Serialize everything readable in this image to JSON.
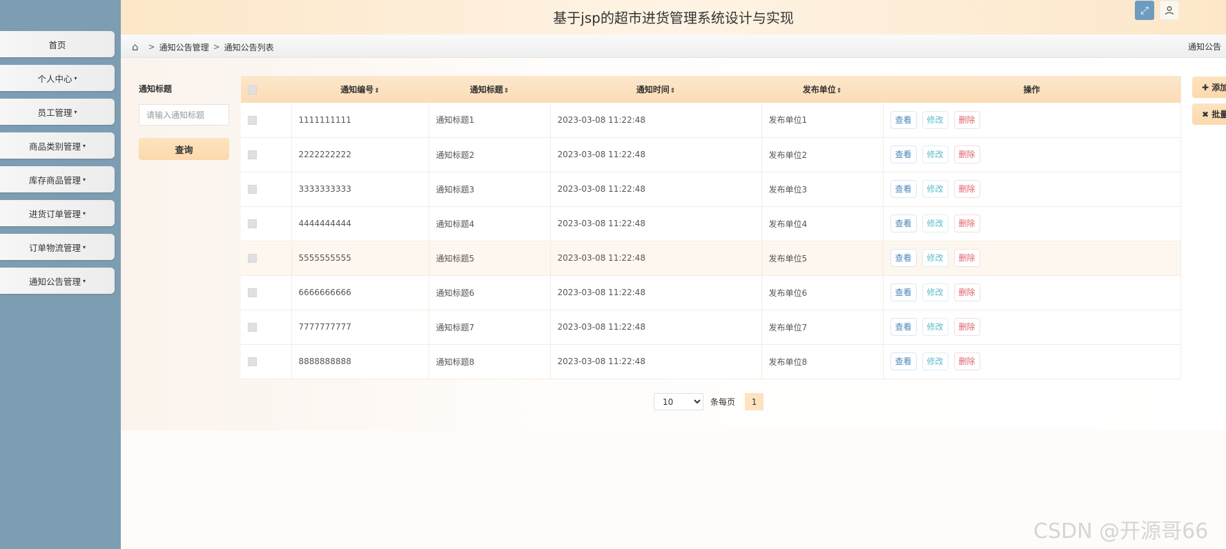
{
  "app": {
    "title": "基于jsp的超市进货管理系统设计与实现",
    "fullscreen_icon": "fullscreen-icon",
    "user_icon": "user-icon"
  },
  "sidebar": {
    "items": [
      {
        "label": "首页",
        "caret": ""
      },
      {
        "label": "个人中心",
        "caret": "▾"
      },
      {
        "label": "员工管理",
        "caret": "▾"
      },
      {
        "label": "商品类别管理",
        "caret": "▾"
      },
      {
        "label": "库存商品管理",
        "caret": "▾"
      },
      {
        "label": "进货订单管理",
        "caret": "▾"
      },
      {
        "label": "订单物流管理",
        "caret": "▾"
      },
      {
        "label": "通知公告管理",
        "caret": "▾"
      }
    ]
  },
  "breadcrumb": {
    "home_icon": "⌂",
    "separator": ">",
    "level1": "通知公告管理",
    "level2": "通知公告列表",
    "right": "通知公告"
  },
  "search": {
    "label": "通知标题",
    "placeholder": "请输入通知标题",
    "button": "查询"
  },
  "actions": {
    "add": "✚ 添加",
    "batch_delete": "✖ 批量删除"
  },
  "table": {
    "sort_glyph": "⇕",
    "columns": [
      "通知编号",
      "通知标题",
      "通知时间",
      "发布单位",
      "操作"
    ],
    "ops": {
      "view": "查看",
      "edit": "修改",
      "delete": "删除"
    },
    "rows": [
      {
        "no": "1111111111",
        "title": "通知标题1",
        "time": "2023-03-08 11:22:48",
        "unit": "发布单位1"
      },
      {
        "no": "2222222222",
        "title": "通知标题2",
        "time": "2023-03-08 11:22:48",
        "unit": "发布单位2"
      },
      {
        "no": "3333333333",
        "title": "通知标题3",
        "time": "2023-03-08 11:22:48",
        "unit": "发布单位3"
      },
      {
        "no": "4444444444",
        "title": "通知标题4",
        "time": "2023-03-08 11:22:48",
        "unit": "发布单位4"
      },
      {
        "no": "5555555555",
        "title": "通知标题5",
        "time": "2023-03-08 11:22:48",
        "unit": "发布单位5"
      },
      {
        "no": "6666666666",
        "title": "通知标题6",
        "time": "2023-03-08 11:22:48",
        "unit": "发布单位6"
      },
      {
        "no": "7777777777",
        "title": "通知标题7",
        "time": "2023-03-08 11:22:48",
        "unit": "发布单位7"
      },
      {
        "no": "8888888888",
        "title": "通知标题8",
        "time": "2023-03-08 11:22:48",
        "unit": "发布单位8"
      }
    ]
  },
  "pagination": {
    "page_size": "10",
    "per_page_label": "条每页",
    "current_page": "1"
  },
  "watermark": "CSDN @开源哥66"
}
